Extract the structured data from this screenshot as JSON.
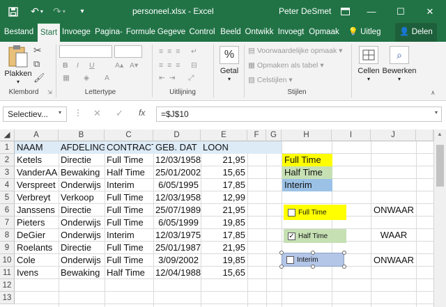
{
  "titlebar": {
    "save_icon": "save-icon",
    "title": "personeel.xlsx - Excel",
    "user": "Peter DeSmet"
  },
  "tabs": [
    {
      "label": "Bestand"
    },
    {
      "label": "Start"
    },
    {
      "label": "Invoege"
    },
    {
      "label": "Pagina-"
    },
    {
      "label": "Formule"
    },
    {
      "label": "Gegeve"
    },
    {
      "label": "Control"
    },
    {
      "label": "Beeld"
    },
    {
      "label": "Ontwikk"
    },
    {
      "label": "Invoegt"
    },
    {
      "label": "Opmaak"
    },
    {
      "label": "Uitleg"
    },
    {
      "label": "Delen"
    }
  ],
  "ribbon": {
    "paste_label": "Plakken",
    "clipboard_label": "Klembord",
    "font_label": "Lettertype",
    "alignment_label": "Uitlijning",
    "number_label": "Getal",
    "number_symbol": "%",
    "cond_format": "Voorwaardelijke opmaak",
    "format_table": "Opmaken als tabel",
    "cell_styles": "Celstijlen",
    "styles_label": "Stijlen",
    "cells_label": "Cellen",
    "editing_label": "Bewerken",
    "bold": "B",
    "italic": "I",
    "underline": "U"
  },
  "formula_bar": {
    "name_box": "Selectiev...",
    "fx": "fx",
    "formula": "=$J$10"
  },
  "columns": [
    "A",
    "B",
    "C",
    "D",
    "E",
    "F",
    "G",
    "H",
    "I",
    "J"
  ],
  "rows": [
    "1",
    "2",
    "3",
    "4",
    "5",
    "6",
    "7",
    "8",
    "9",
    "10",
    "11",
    "12",
    "13"
  ],
  "table": {
    "headers": [
      "NAAM",
      "AFDELING",
      "CONTRACT",
      "GEB. DAT",
      "LOON"
    ],
    "data": [
      [
        "Ketels",
        "Directie",
        "Full Time",
        "12/03/1958",
        "21,95"
      ],
      [
        "VanderAA",
        "Bewaking",
        "Half Time",
        "25/01/2002",
        "15,65"
      ],
      [
        "Verspreet",
        "Onderwijs",
        "Interim",
        "6/05/1995",
        "17,85"
      ],
      [
        "Verbreyt",
        "Verkoop",
        "Full Time",
        "12/03/1958",
        "12,99"
      ],
      [
        "Janssens",
        "Directie",
        "Full Time",
        "25/07/1989",
        "21,95"
      ],
      [
        "Pieters",
        "Onderwijs",
        "Full Time",
        "6/05/1999",
        "19,85"
      ],
      [
        "DeGier",
        "Onderwijs",
        "Interim",
        "12/03/1975",
        "17,85"
      ],
      [
        "Roelants",
        "Directie",
        "Full Time",
        "25/01/1987",
        "21,95"
      ],
      [
        "Cole",
        "Onderwijs",
        "Full Time",
        "3/09/2002",
        "19,85"
      ],
      [
        "Ivens",
        "Bewaking",
        "Half Time",
        "12/04/1988",
        "15,65"
      ]
    ]
  },
  "legend": {
    "full_time": "Full Time",
    "half_time": "Half Time",
    "interim": "Interim",
    "colors": {
      "full_time": "#ffff00",
      "half_time": "#c6e0b4",
      "interim": "#9bc2e6"
    }
  },
  "checkboxes": [
    {
      "label": "Full Time",
      "checked": false,
      "result": "ONWAAR"
    },
    {
      "label": "Half Time",
      "checked": true,
      "result": "WAAR"
    },
    {
      "label": "Interim",
      "checked": false,
      "result": "ONWAAR"
    }
  ]
}
